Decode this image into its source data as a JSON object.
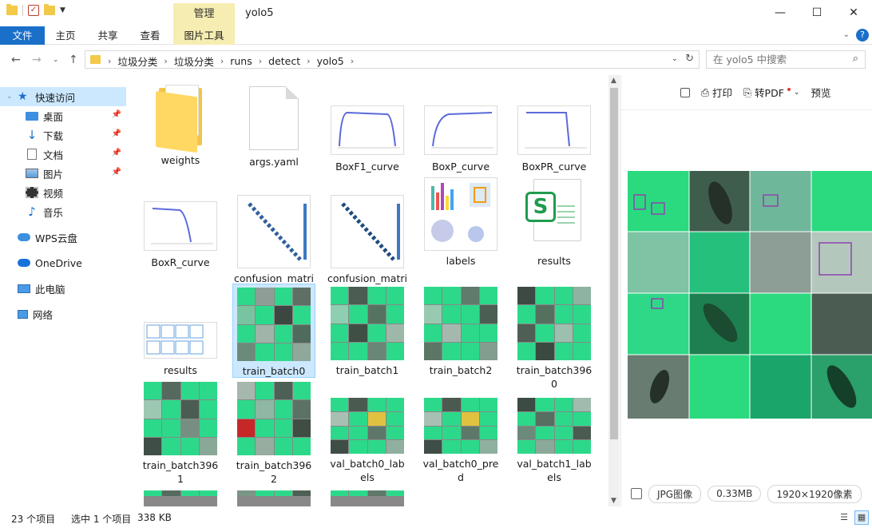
{
  "window": {
    "title": "yolo5",
    "context_tab": "管理",
    "controls": {
      "minimize": "—",
      "maximize": "☐",
      "close": "✕"
    }
  },
  "ribbon": {
    "tabs": [
      "文件",
      "主页",
      "共享",
      "查看",
      "图片工具"
    ],
    "accent": "#1a6fc9",
    "context_color": "#f6edb2"
  },
  "address": {
    "breadcrumbs": [
      "垃圾分类",
      "垃圾分类",
      "runs",
      "detect",
      "yolo5"
    ],
    "search_placeholder": "在 yolo5 中搜索"
  },
  "sidebar": {
    "items": [
      {
        "label": "快速访问",
        "icon": "star-icon",
        "pinned": false,
        "highlight": true
      },
      {
        "label": "桌面",
        "icon": "desktop-icon",
        "pinned": true
      },
      {
        "label": "下载",
        "icon": "download-icon",
        "pinned": true
      },
      {
        "label": "文档",
        "icon": "document-icon",
        "pinned": true
      },
      {
        "label": "图片",
        "icon": "picture-icon",
        "pinned": true
      },
      {
        "label": "视频",
        "icon": "video-icon",
        "pinned": false
      },
      {
        "label": "音乐",
        "icon": "music-icon",
        "pinned": false
      },
      {
        "label": "WPS云盘",
        "icon": "cloud-icon",
        "pinned": false
      },
      {
        "label": "OneDrive",
        "icon": "onedrive-icon",
        "pinned": false
      },
      {
        "label": "此电脑",
        "icon": "computer-icon",
        "pinned": false
      },
      {
        "label": "网络",
        "icon": "network-icon",
        "pinned": false
      }
    ]
  },
  "files": [
    {
      "name": "weights",
      "kind": "folder"
    },
    {
      "name": "args.yaml",
      "kind": "doc"
    },
    {
      "name": "BoxF1_curve",
      "kind": "curve"
    },
    {
      "name": "BoxP_curve",
      "kind": "curve"
    },
    {
      "name": "BoxPR_curve",
      "kind": "curve"
    },
    {
      "name": "BoxR_curve",
      "kind": "curve"
    },
    {
      "name": "confusion_matrix",
      "kind": "matrix"
    },
    {
      "name": "confusion_matrix_normalized",
      "kind": "matrix"
    },
    {
      "name": "labels",
      "kind": "labels"
    },
    {
      "name": "results",
      "kind": "xlsx"
    },
    {
      "name": "results",
      "kind": "results"
    },
    {
      "name": "train_batch0",
      "kind": "mosaic",
      "selected": true
    },
    {
      "name": "train_batch1",
      "kind": "mosaic"
    },
    {
      "name": "train_batch2",
      "kind": "mosaic"
    },
    {
      "name": "train_batch3960",
      "kind": "mosaic"
    },
    {
      "name": "train_batch3961",
      "kind": "mosaic"
    },
    {
      "name": "train_batch3962",
      "kind": "mosaic"
    },
    {
      "name": "val_batch0_labels",
      "kind": "mosaic"
    },
    {
      "name": "val_batch0_pred",
      "kind": "mosaic"
    },
    {
      "name": "val_batch1_labels",
      "kind": "mosaic"
    }
  ],
  "preview": {
    "toolbar": {
      "print": "打印",
      "to_pdf": "转PDF",
      "preview": "预览"
    },
    "footer": {
      "type": "JPG图像",
      "size": "0.33MB",
      "dimensions": "1920×1920像素"
    }
  },
  "status": {
    "count": "23 个项目",
    "selected": "选中 1 个项目",
    "size": "338 KB"
  }
}
